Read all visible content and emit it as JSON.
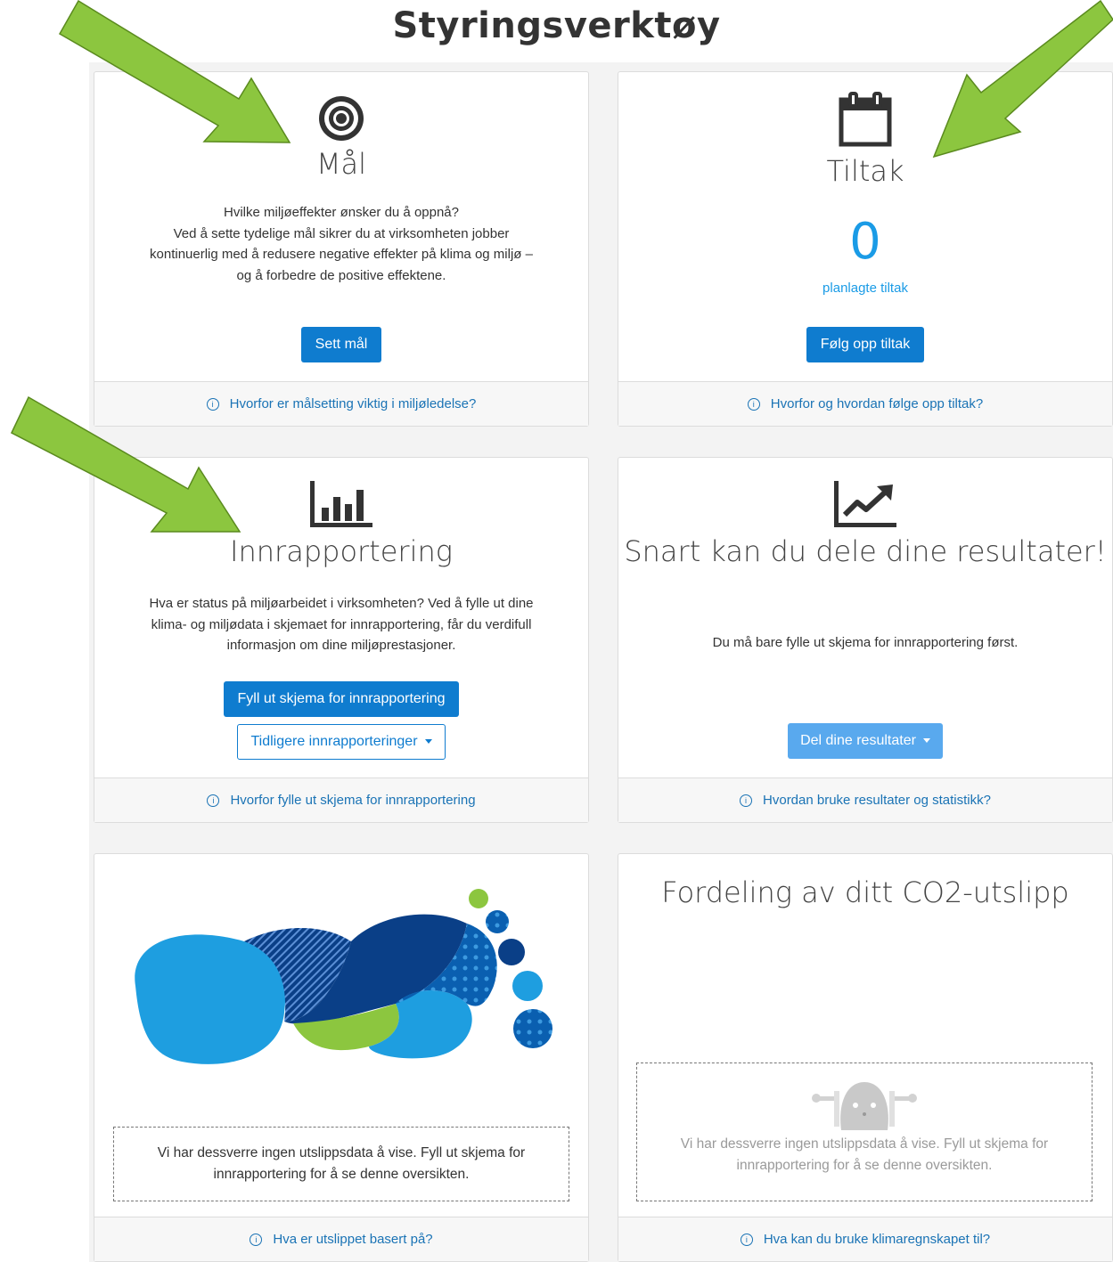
{
  "page": {
    "title": "Styringsverktøy"
  },
  "colors": {
    "primary": "#0f7ccf",
    "link": "#1a73b5",
    "arrow": "#8cc63f",
    "arrow_border": "#5a8a1e"
  },
  "cards": {
    "goals": {
      "icon": "target-icon",
      "title": "Mål",
      "text_lines": [
        "Hvilke miljøeffekter ønsker du å oppnå?",
        "Ved å sette tydelige mål sikrer du at virksomheten jobber",
        "kontinuerlig med å redusere negative effekter på klima og miljø –",
        "og å forbedre de positive effektene."
      ],
      "button": "Sett mål",
      "footer": "Hvorfor er målsetting viktig i miljøledelse?"
    },
    "actions": {
      "icon": "calendar-icon",
      "title": "Tiltak",
      "count": "0",
      "count_label": "planlagte tiltak",
      "button": "Følg opp tiltak",
      "footer": "Hvorfor og hvordan følge opp tiltak?"
    },
    "reporting": {
      "icon": "bar-chart-icon",
      "title": "Innrapportering",
      "text_lines": [
        "Hva er status på miljøarbeidet i virksomheten? Ved å fylle ut dine",
        "klima- og miljødata i skjemaet for innrapportering, får du verdifull",
        "informasjon om dine miljøprestasjoner."
      ],
      "button": "Fyll ut skjema for innrapportering",
      "dropdown": "Tidligere innrapporteringer",
      "footer": "Hvorfor fylle ut skjema for innrapportering"
    },
    "share": {
      "icon": "trending-up-icon",
      "title": "Snart kan du dele dine resultater!",
      "text": "Du må bare fylle ut skjema for innrapportering først.",
      "button": "Del dine resultater",
      "footer": "Hvordan bruke resultater og statistikk?"
    },
    "footprint": {
      "icon": "footprint-illustration",
      "message_lines": [
        "Vi har dessverre ingen utslippsdata å vise. Fyll ut skjema for",
        "innrapportering for å se denne oversikten."
      ],
      "footer": "Hva er utslippet basert på?"
    },
    "co2": {
      "icon": "sad-robot-icon",
      "title": "Fordeling av ditt CO2-utslipp",
      "message_lines": [
        "Vi har dessverre ingen utslippsdata å vise. Fyll ut skjema for",
        "innrapportering for å se denne oversikten."
      ],
      "footer": "Hva kan du bruke klimaregnskapet til?"
    }
  }
}
